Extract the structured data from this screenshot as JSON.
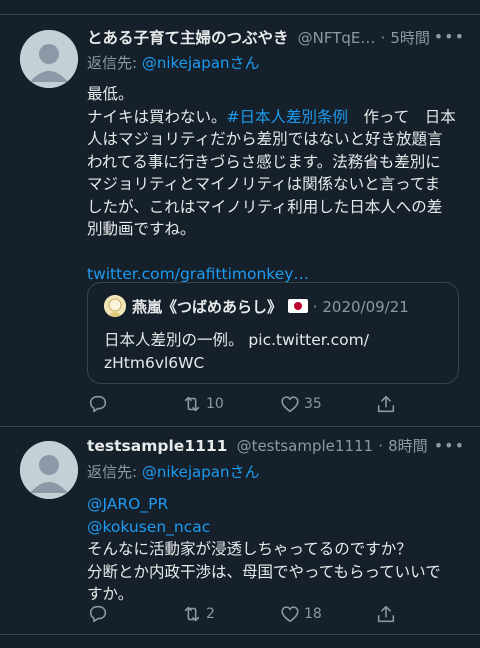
{
  "tweets": [
    {
      "display_name": "とある子育て主婦のつぶやき",
      "handle": "@NFTqE…",
      "separator": "·",
      "time": "5時間",
      "more": "•••",
      "reply_prefix": "返信先: ",
      "reply_mention": "@nikejapan",
      "reply_suffix": "さん",
      "body": {
        "line1": "最低。",
        "line2_a": "ナイキは買わない。",
        "line2_tag": "#日本人差別条例",
        "line2_b": "　作って　日本",
        "line3": "人はマジョリティだから差別ではないと好き放題言",
        "line4": "われてる事に行きづらさ感じます。法務省も差別に",
        "line5": "マジョリティとマイノリティは関係ないと言ってま",
        "line6": "したが、これはマイノリティ利用した日本人への差",
        "line7": "別動画ですね。",
        "link": "twitter.com/grafittimonkey…"
      },
      "quote": {
        "name": "燕嵐《つばめあらし》",
        "separator": "·",
        "date": "2020/09/21",
        "line1": "日本人差別の一例。 pic.twitter.com/",
        "line2": "zHtm6vl6WC"
      },
      "actions": {
        "reply": "",
        "retweet": "10",
        "like": "35"
      },
      "icons": [
        "reply-icon",
        "retweet-icon",
        "like-icon",
        "share-icon"
      ]
    },
    {
      "display_name": "testsample1111",
      "handle": "@testsample1111",
      "separator": "·",
      "time": "8時間",
      "more": "•••",
      "reply_prefix": "返信先: ",
      "reply_mention": "@nikejapan",
      "reply_suffix": "さん",
      "body": {
        "mention1": "@JARO_PR",
        "mention2": "@kokusen_ncac",
        "line1": "そんなに活動家が浸透しちゃってるのですか？",
        "line2": "分断とか内政干渉は、母国でやってもらっていいで",
        "line3": "すか。"
      },
      "actions": {
        "reply": "",
        "retweet": "2",
        "like": "18"
      }
    }
  ],
  "colors": {
    "background": "#15202b",
    "text": "#e7e9ea",
    "secondary": "#8b98a5",
    "accent": "#1d9bf0",
    "border": "#38444d"
  }
}
